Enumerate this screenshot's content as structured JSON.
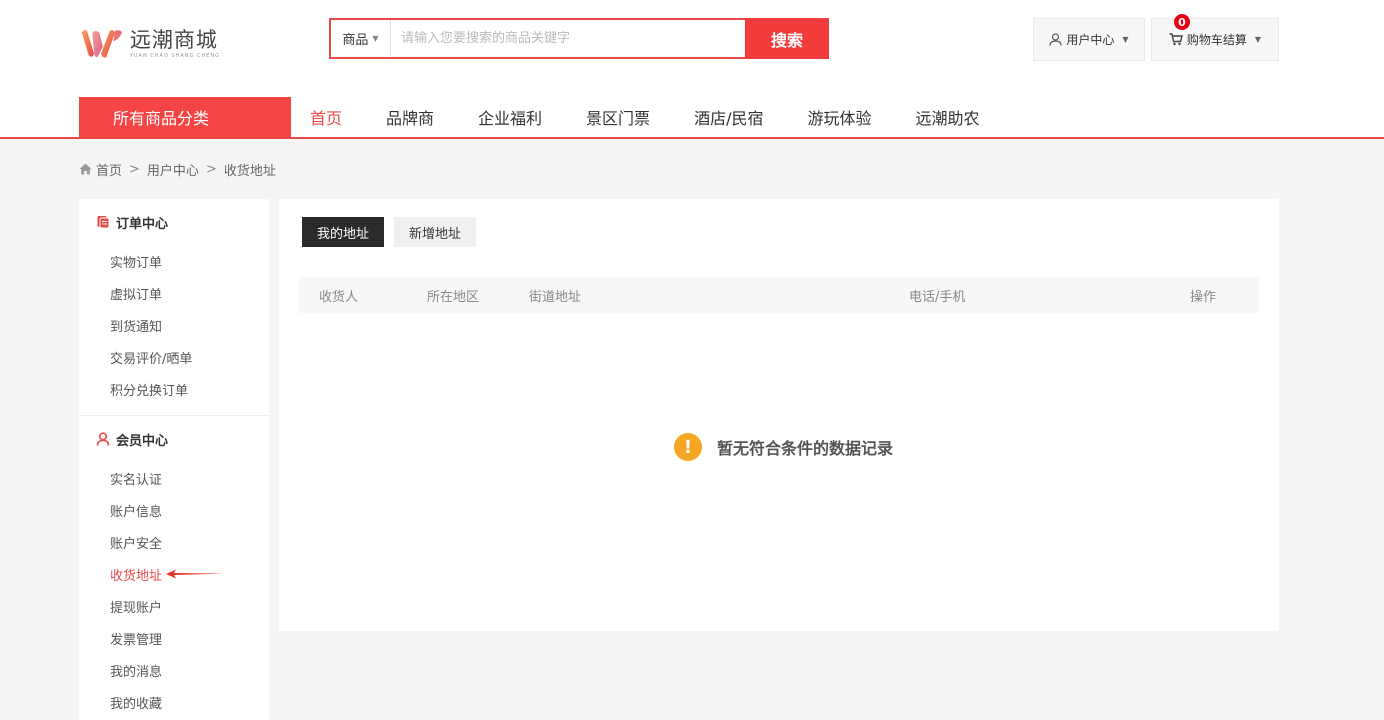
{
  "header": {
    "logo": {
      "name": "远潮商城",
      "sub": "YUAN CHAO SHANG CHENG"
    },
    "search": {
      "type_label": "商品",
      "placeholder": "请输入您要搜索的商品关键字",
      "value": "",
      "button_label": "搜索"
    },
    "user_center": {
      "label": "用户中心"
    },
    "cart": {
      "label": "购物车结算",
      "count": "0"
    }
  },
  "nav": {
    "all_categories": "所有商品分类",
    "items": [
      {
        "label": "首页",
        "active": true
      },
      {
        "label": "品牌商"
      },
      {
        "label": "企业福利"
      },
      {
        "label": "景区门票"
      },
      {
        "label": "酒店/民宿"
      },
      {
        "label": "游玩体验"
      },
      {
        "label": "远潮助农"
      }
    ]
  },
  "breadcrumb": [
    "首页",
    "用户中心",
    "收货地址"
  ],
  "sidebar": {
    "groups": [
      {
        "title": "订单中心",
        "items": [
          "实物订单",
          "虚拟订单",
          "到货通知",
          "交易评价/晒单",
          "积分兑换订单"
        ]
      },
      {
        "title": "会员中心",
        "items": [
          "实名认证",
          "账户信息",
          "账户安全",
          "收货地址",
          "提现账户",
          "发票管理",
          "我的消息",
          "我的收藏"
        ]
      }
    ],
    "active_item": "收货地址"
  },
  "content": {
    "tabs": [
      {
        "label": "我的地址",
        "active": true
      },
      {
        "label": "新增地址"
      }
    ],
    "table_headers": [
      "收货人",
      "所在地区",
      "街道地址",
      "电话/手机",
      "操作"
    ],
    "empty_message": "暂无符合条件的数据记录"
  },
  "colors": {
    "accent": "#e84a4a",
    "nav_all_bg": "#f44444",
    "warning": "#f5a623"
  }
}
